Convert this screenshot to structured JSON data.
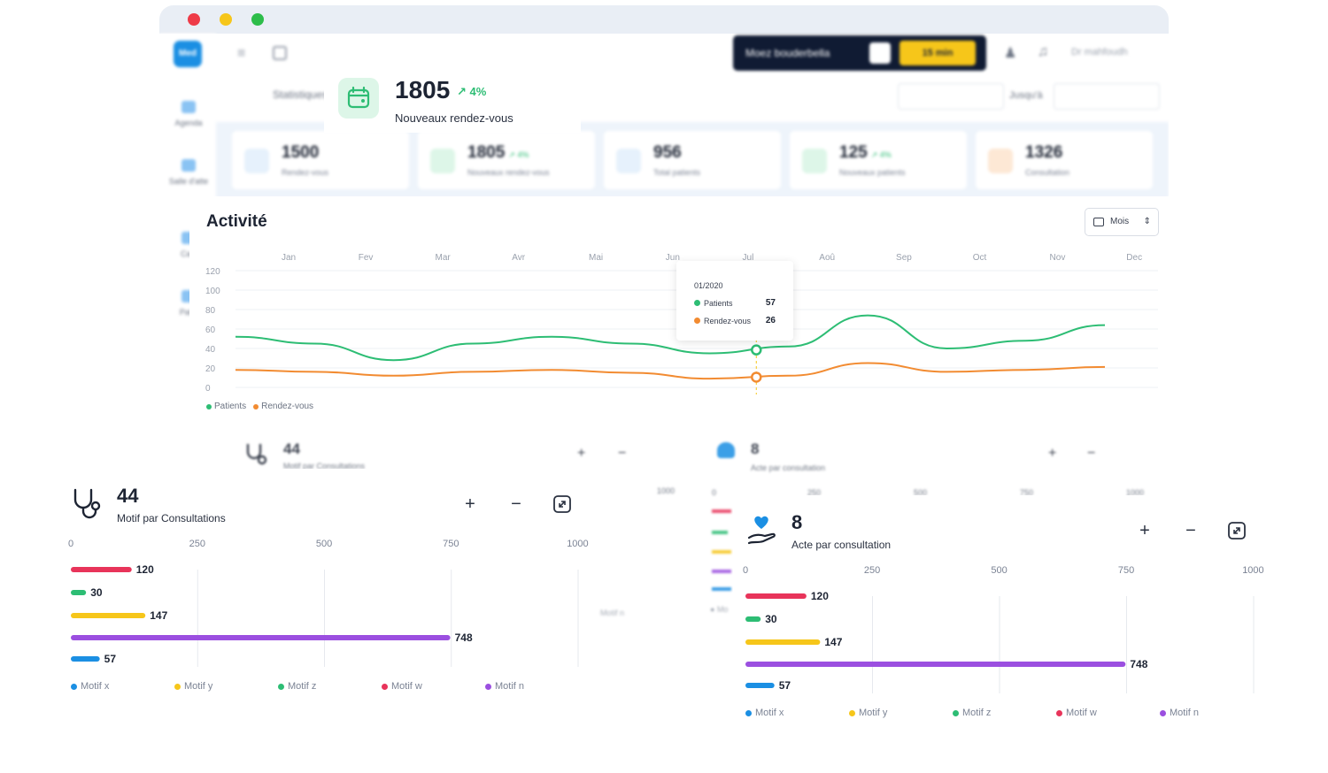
{
  "window": {
    "controls": [
      "close",
      "minimize",
      "maximize"
    ],
    "logo": "Med",
    "sidebar": [
      {
        "label": "Agenda",
        "icon": "calendar-icon"
      },
      {
        "label": "Salle d'atte",
        "icon": "waiting-room-icon"
      },
      {
        "label": "Cais",
        "icon": "cash-icon"
      },
      {
        "label": "Patie",
        "icon": "patients-icon"
      }
    ],
    "user_pill": {
      "name": "Moez bouderbella",
      "timer": "15 min"
    },
    "doctor": "Dr mahfoudh",
    "page_title": "Statistiques",
    "date_to_label": "Jusqu'à",
    "stats": [
      {
        "value": "1500",
        "label": "Rendez-vous",
        "trend": "",
        "color": "#e6f1fc",
        "icon": "calendar-icon"
      },
      {
        "value": "1805",
        "label": "Nouveaux rendez-vous",
        "trend": "↗ 4%",
        "color": "#ddf6e8",
        "icon": "calendar-plus-icon"
      },
      {
        "value": "956",
        "label": "Total patients",
        "trend": "",
        "color": "#e6f1fc",
        "icon": "users-icon"
      },
      {
        "value": "125",
        "label": "Nouveaux patients",
        "trend": "↗ 4%",
        "color": "#ddf6e8",
        "icon": "user-plus-icon"
      },
      {
        "value": "1326",
        "label": "Consultation",
        "trend": "",
        "color": "#fde8d5",
        "icon": "clipboard-icon"
      }
    ]
  },
  "highlight": {
    "value": "1805",
    "trend": "↗ 4%",
    "label": "Nouveaux rendez-vous",
    "color": "#2dbd74"
  },
  "activity": {
    "title": "Activité",
    "period_select": "Mois",
    "tooltip": {
      "date": "01/2020",
      "rows": [
        {
          "name": "Patients",
          "value": "57"
        },
        {
          "name": "Rendez-vous",
          "value": "26"
        }
      ]
    },
    "legend": [
      "Patients",
      "Rendez-vous"
    ],
    "chart_data": {
      "type": "line",
      "x": [
        "Jan",
        "Fev",
        "Mar",
        "Avr",
        "Mai",
        "Jun",
        "Jul",
        "Aoû",
        "Sep",
        "Oct",
        "Nov",
        "Dec"
      ],
      "ylim": [
        0,
        120
      ],
      "y_ticks": [
        0,
        20,
        40,
        60,
        80,
        100,
        120
      ],
      "series": [
        {
          "name": "Patients",
          "color": "#2dbd74",
          "values": [
            52,
            45,
            28,
            45,
            52,
            45,
            35,
            42,
            74,
            40,
            48,
            64
          ]
        },
        {
          "name": "Rendez-vous",
          "color": "#f28b31",
          "values": [
            18,
            16,
            12,
            16,
            18,
            15,
            9,
            12,
            25,
            16,
            18,
            21
          ]
        }
      ]
    }
  },
  "panels": [
    {
      "count": "44",
      "title": "Motif par Consultations",
      "icon": "stethoscope-icon",
      "chart_data": {
        "type": "bar",
        "orientation": "horizontal",
        "xlim": [
          0,
          1000
        ],
        "x_ticks": [
          "0",
          "250",
          "500",
          "750",
          "1000"
        ],
        "bars": [
          {
            "value": 120,
            "color": "#e8345a"
          },
          {
            "value": 30,
            "color": "#2dbd74"
          },
          {
            "value": 147,
            "color": "#f6c61a"
          },
          {
            "value": 748,
            "color": "#9b4fe0"
          },
          {
            "value": 57,
            "color": "#1b8fe3"
          }
        ],
        "legend": [
          {
            "name": "Motif x",
            "color": "#1b8fe3"
          },
          {
            "name": "Motif y",
            "color": "#f6c61a"
          },
          {
            "name": "Motif z",
            "color": "#2dbd74"
          },
          {
            "name": "Motif w",
            "color": "#e8345a"
          },
          {
            "name": "Motif n",
            "color": "#9b4fe0"
          }
        ]
      }
    },
    {
      "count": "8",
      "title": "Acte par consultation",
      "icon": "care-hand-icon",
      "chart_data": {
        "type": "bar",
        "orientation": "horizontal",
        "xlim": [
          0,
          1000
        ],
        "x_ticks": [
          "0",
          "250",
          "500",
          "750",
          "1000"
        ],
        "bars": [
          {
            "value": 120,
            "color": "#e8345a"
          },
          {
            "value": 30,
            "color": "#2dbd74"
          },
          {
            "value": 147,
            "color": "#f6c61a"
          },
          {
            "value": 748,
            "color": "#9b4fe0"
          },
          {
            "value": 57,
            "color": "#1b8fe3"
          }
        ],
        "legend": [
          {
            "name": "Motif x",
            "color": "#1b8fe3"
          },
          {
            "name": "Motif y",
            "color": "#f6c61a"
          },
          {
            "name": "Motif z",
            "color": "#2dbd74"
          },
          {
            "name": "Motif w",
            "color": "#e8345a"
          },
          {
            "name": "Motif n",
            "color": "#9b4fe0"
          }
        ]
      }
    }
  ],
  "ghost_panels": [
    {
      "count": "44",
      "title": "Motif par Consultations"
    },
    {
      "count": "8",
      "title": "Acte par consultation",
      "ticks": [
        "0",
        "250",
        "500",
        "750",
        "1000"
      ],
      "legend_clip": "Motif n",
      "legend_clip2": "Mo"
    }
  ],
  "ghost_tick_1000": "1000"
}
